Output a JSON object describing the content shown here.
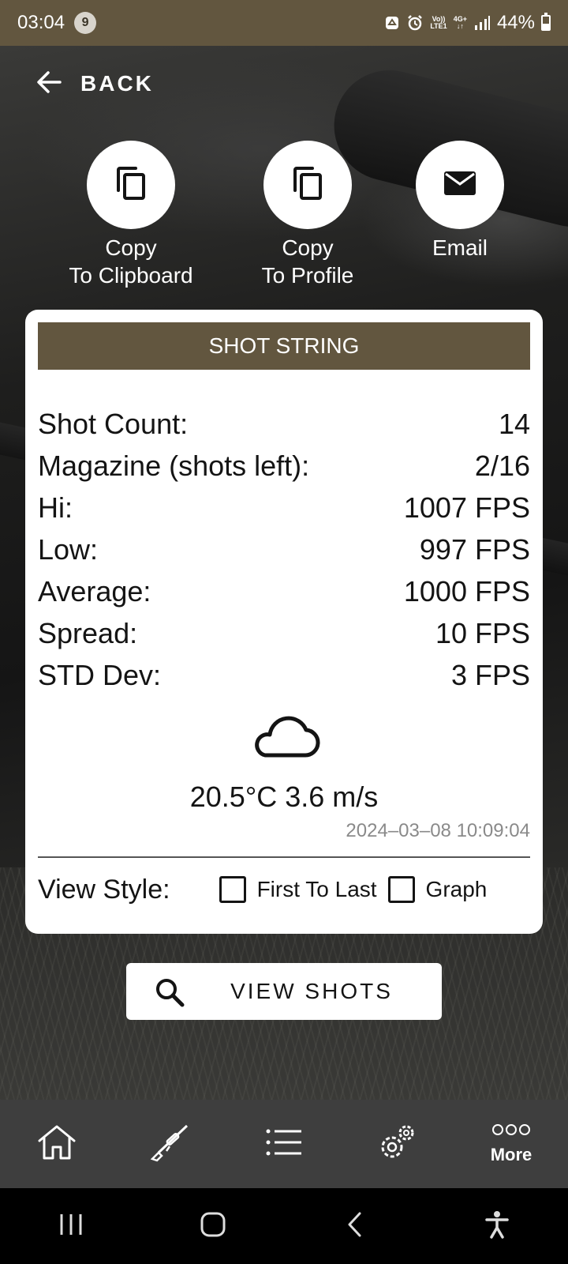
{
  "status_bar": {
    "time": "03:04",
    "notification_count": "9",
    "volte_label": "Vo))",
    "lte_label": "LTE1",
    "network_type": "4G+",
    "battery_percent": "44%"
  },
  "back": {
    "label": "BACK"
  },
  "actions": [
    {
      "line1": "Copy",
      "line2": "To Clipboard",
      "icon": "copy-icon"
    },
    {
      "line1": "Copy",
      "line2": "To Profile",
      "icon": "copy-icon"
    },
    {
      "line1": "Email",
      "line2": "",
      "icon": "email-icon"
    }
  ],
  "card": {
    "title": "SHOT STRING",
    "stats": [
      {
        "label": "Shot Count:",
        "value": "14"
      },
      {
        "label": "Magazine (shots left):",
        "value": "2/16"
      },
      {
        "label": "Hi:",
        "value": "1007 FPS"
      },
      {
        "label": "Low:",
        "value": "997 FPS"
      },
      {
        "label": "Average:",
        "value": "1000 FPS"
      },
      {
        "label": "Spread:",
        "value": "10 FPS"
      },
      {
        "label": "STD Dev:",
        "value": "3 FPS"
      }
    ],
    "weather_icon": "cloud-icon",
    "weather_text": "20.5°C 3.6 m/s",
    "timestamp": "2024–03–08 10:09:04",
    "view_style": {
      "label": "View Style:",
      "options": [
        {
          "label": "First To Last",
          "checked": false
        },
        {
          "label": "Graph",
          "checked": false
        }
      ]
    }
  },
  "view_shots_button": {
    "label": "VIEW SHOTS",
    "icon": "search-icon"
  },
  "bottom_nav": {
    "items": [
      "home-icon",
      "rifle-icon",
      "list-icon",
      "settings-icon",
      "more-icon"
    ],
    "more_label": "More"
  },
  "system_nav": [
    "recents-icon",
    "home-icon",
    "back-icon",
    "accessibility-icon"
  ],
  "colors": {
    "brand": "#62563f",
    "nav_background": "#3e3e3e",
    "card_background": "#ffffff"
  }
}
